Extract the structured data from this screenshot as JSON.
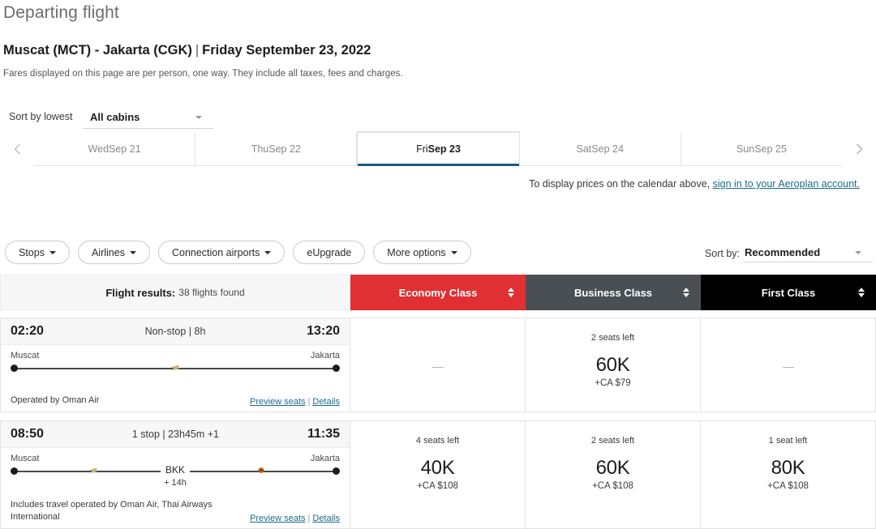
{
  "header": {
    "title": "Departing flight",
    "route": "Muscat (MCT) - Jakarta (CGK)",
    "route_separator": "|",
    "date": "Friday September 23, 2022",
    "fares_note": "Fares displayed on this page are per person, one way. They include all taxes, fees and charges."
  },
  "cabin_sort": {
    "sort_by_lowest_label": "Sort by lowest",
    "cabins_selected": "All cabins",
    "caret_icon": "chevron-down-icon"
  },
  "date_strip": {
    "prev_icon": "chevron-left-icon",
    "next_icon": "chevron-right-icon",
    "tabs": [
      {
        "dow": "Wed ",
        "num": "Sep 21",
        "active": false
      },
      {
        "dow": "Thu ",
        "num": "Sep 22",
        "active": false
      },
      {
        "dow": "Fri ",
        "num": "Sep 23",
        "active": true
      },
      {
        "dow": "Sat ",
        "num": "Sep 24",
        "active": false
      },
      {
        "dow": "Sun ",
        "num": "Sep 25",
        "active": false
      }
    ]
  },
  "signin": {
    "text": "To display prices on the calendar above, ",
    "link": "sign in to your Aeroplan account."
  },
  "filters": [
    {
      "label": "Stops",
      "caret": true
    },
    {
      "label": "Airlines",
      "caret": true
    },
    {
      "label": "Connection airports",
      "caret": true
    },
    {
      "label": "eUpgrade",
      "caret": false
    },
    {
      "label": "More options",
      "caret": true
    }
  ],
  "sortby": {
    "label": "Sort by:",
    "value": "Recommended",
    "caret_icon": "chevron-down-icon"
  },
  "results_header": {
    "results_label": "Flight results:",
    "results_count": "38 flights found",
    "columns": [
      {
        "label": "Economy Class",
        "color": "#e03033",
        "sort_icon": "sort-updown-icon"
      },
      {
        "label": "Business Class",
        "color": "#4a4f54",
        "sort_icon": "sort-updown-icon"
      },
      {
        "label": "First Class",
        "color": "#000000",
        "sort_icon": "sort-updown-icon"
      }
    ]
  },
  "flights": [
    {
      "depart_time": "02:20",
      "arrive_time": "13:20",
      "summary": "Non-stop | 8h",
      "origin": "Muscat",
      "destination": "Jakarta",
      "stop_code": "",
      "stop_duration": "",
      "operated_by": "Operated by Oman Air",
      "preview_seats": "Preview seats",
      "details": "Details",
      "link_separator": "|",
      "fares": [
        {
          "seats": "",
          "points": "",
          "cash": "",
          "unavailable": true
        },
        {
          "seats": "2 seats left",
          "points": "60K",
          "cash": "+CA $79",
          "unavailable": false
        },
        {
          "seats": "",
          "points": "",
          "cash": "",
          "unavailable": true
        }
      ]
    },
    {
      "depart_time": "08:50",
      "arrive_time": "11:35",
      "summary": "1 stop | 23h45m +1",
      "origin": "Muscat",
      "destination": "Jakarta",
      "stop_code": "BKK",
      "stop_duration": "+ 14h",
      "operated_by": "Includes travel operated by Oman Air, Thai Airways International",
      "preview_seats": "Preview seats",
      "details": "Details",
      "link_separator": "|",
      "fares": [
        {
          "seats": "4 seats left",
          "points": "40K",
          "cash": "+CA $108",
          "unavailable": false
        },
        {
          "seats": "2 seats left",
          "points": "60K",
          "cash": "+CA $108",
          "unavailable": false
        },
        {
          "seats": "1 seat left",
          "points": "80K",
          "cash": "+CA $108",
          "unavailable": false
        }
      ]
    }
  ]
}
